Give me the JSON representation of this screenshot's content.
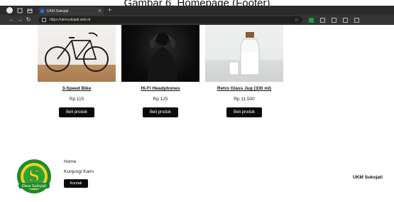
{
  "caption": "Gambar 6. Homepage (Footer)",
  "browser": {
    "tab_title": "UKM Sukojati",
    "url": "https://ukmsukojati.web.id"
  },
  "products": [
    {
      "name": "3-Speed Bike",
      "price": "Rp 115",
      "button": "Beli produk",
      "image": "bicycle-photo"
    },
    {
      "name": "Hi-Fi Headphones",
      "price": "Rp 125",
      "button": "Beli produk",
      "image": "headphones-photo"
    },
    {
      "name": "Retro Glass Jug (330 ml)",
      "price": "Rp 11.500",
      "button": "Beli produk",
      "image": "glass-jug-photo"
    }
  ],
  "footer": {
    "links": [
      "Home",
      "Kunjungi Kami"
    ],
    "contact_button": "Kontak",
    "brand": "UKM Sukojati",
    "logo_letter": "S",
    "logo_text": "Desa Sukojati"
  },
  "colors": {
    "button_bg": "#0a0a0a",
    "browser_chrome": "#2b2b2b",
    "logo_green": "#1f8a2e",
    "logo_yellow": "#f2d21b"
  }
}
